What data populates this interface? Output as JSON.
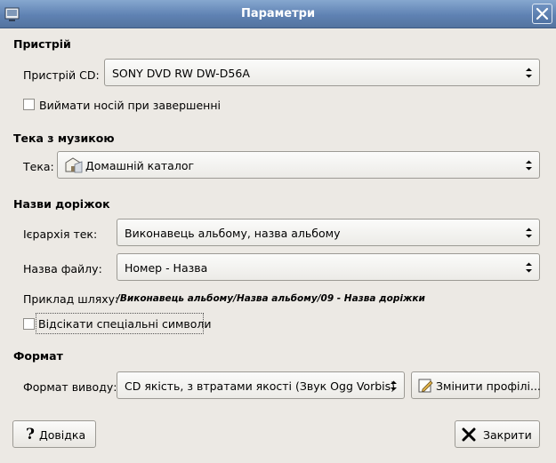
{
  "window": {
    "title": "Параметри"
  },
  "sections": {
    "device": {
      "title": "Пристрій",
      "cd_label": "Пристрій CD:",
      "cd_value": "SONY DVD RW DW-D56A",
      "eject_label": "Виймати носій при завершенні",
      "eject_checked": false
    },
    "music_folder": {
      "title": "Тека з музикою",
      "folder_label": "Тека:",
      "folder_value": "Домашній каталог"
    },
    "track_names": {
      "title": "Назви доріжок",
      "hierarchy_label": "Ієрархія тек:",
      "hierarchy_value": "Виконавець альбому, назва альбому",
      "filename_label": "Назва файлу:",
      "filename_value": "Номер - Назва",
      "example_label": "Приклад шляху:",
      "example_value": "/Виконавець альбому/Назва альбому/09 - Назва доріжки",
      "strip_label": "Відсікати спеціальні символи",
      "strip_checked": false
    },
    "format": {
      "title": "Формат",
      "output_label": "Формат виводу:",
      "output_value": "CD якість, з втратами якості (Звук Ogg Vorbis)",
      "edit_profiles_label": "Змінити профілі..."
    }
  },
  "buttons": {
    "help_label": "Довідка",
    "close_label": "Закрити"
  },
  "icons": {
    "app": "app-icon",
    "close": "close-icon",
    "folder": "home-folder-icon",
    "edit": "edit-icon",
    "help": "help-icon",
    "close_button": "x-icon"
  },
  "colors": {
    "titlebar": "#5f82b3",
    "background": "#ece9e4"
  }
}
